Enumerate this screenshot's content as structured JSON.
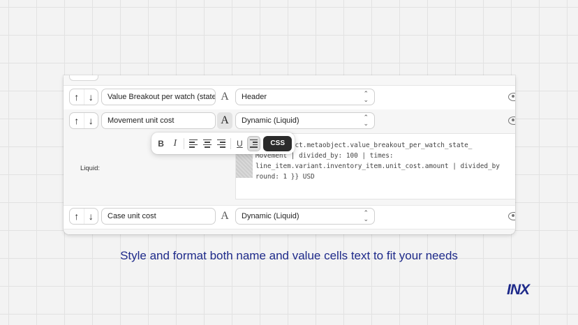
{
  "rows": [
    {
      "name": "Value Breakout per watch (state",
      "type": "Header"
    },
    {
      "name": "Movement unit cost",
      "type": "Dynamic (Liquid)"
    },
    {
      "name": "Case unit cost",
      "type": "Dynamic (Liquid)"
    }
  ],
  "icons": {
    "up": "↑",
    "down": "↓",
    "font": "A",
    "chevron": "⌃⌄",
    "bold": "B",
    "italic": "I",
    "underline": "U"
  },
  "liquid": {
    "label": "Liquid:",
    "code": "item.product.metaobject.value_breakout_per_watch_state_\nMovement | divided_by: 100 | times:\nline_item.variant.inventory_item.unit_cost.amount | divided_by\nround: 1 }} USD"
  },
  "toolbar": {
    "css_label": "CSS"
  },
  "caption": "Style and format both name and value cells text to fit your needs",
  "logo": "INX",
  "colors": {
    "accent": "#1e2a8a",
    "css_button": "#2b2b2b"
  }
}
